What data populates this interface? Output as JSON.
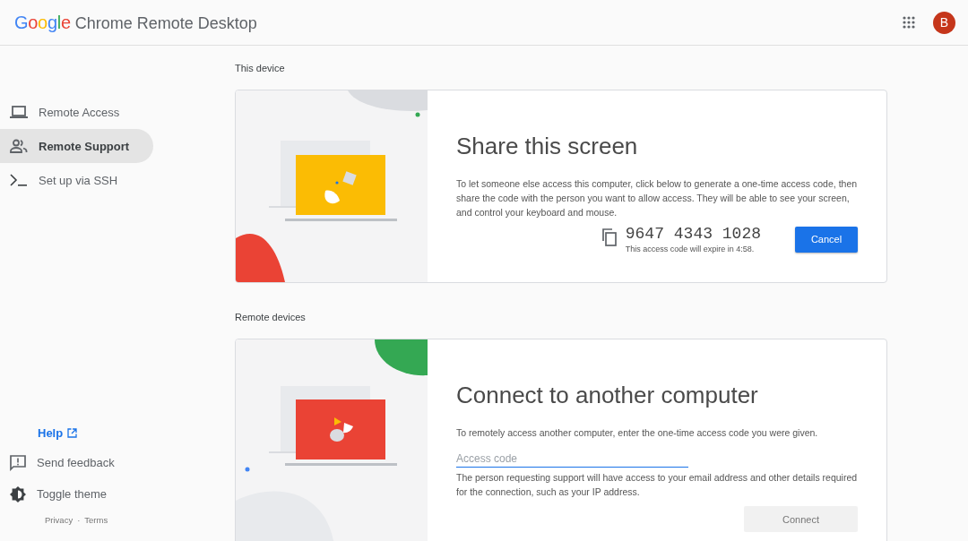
{
  "header": {
    "logo": "Google",
    "product": "Chrome Remote Desktop",
    "avatar": "B"
  },
  "sidebar": {
    "items": [
      {
        "label": "Remote Access",
        "kind": "laptop",
        "selected": false
      },
      {
        "label": "Remote Support",
        "kind": "people",
        "selected": true
      },
      {
        "label": "Set up via SSH",
        "kind": "terminal",
        "selected": false
      }
    ],
    "help": "Help",
    "bottom_items": [
      {
        "label": "Send feedback",
        "kind": "feedback"
      },
      {
        "label": "Toggle theme",
        "kind": "theme"
      }
    ],
    "footer_links": [
      "Privacy",
      "Terms"
    ],
    "footer_separator": "·"
  },
  "sections": [
    {
      "heading": "This device",
      "kind": "share",
      "title": "Share this screen",
      "description": "To let someone else access this computer, click below to generate a one-time access code, then share the code with the person you want to allow access. They will be able to see your screen, and control your keyboard and mouse.",
      "code": "9647 4343 1028",
      "expiry": "This access code will expire in 4:58.",
      "button": "Cancel",
      "button_disabled": false
    },
    {
      "heading": "Remote devices",
      "kind": "connect",
      "title": "Connect to another computer",
      "description": "To remotely access another computer, enter the one-time access code you were given.",
      "placeholder": "Access code",
      "note": "The person requesting support will have access to your email address and other details required for the connection, such as your IP address.",
      "button": "Connect",
      "button_disabled": true
    }
  ]
}
